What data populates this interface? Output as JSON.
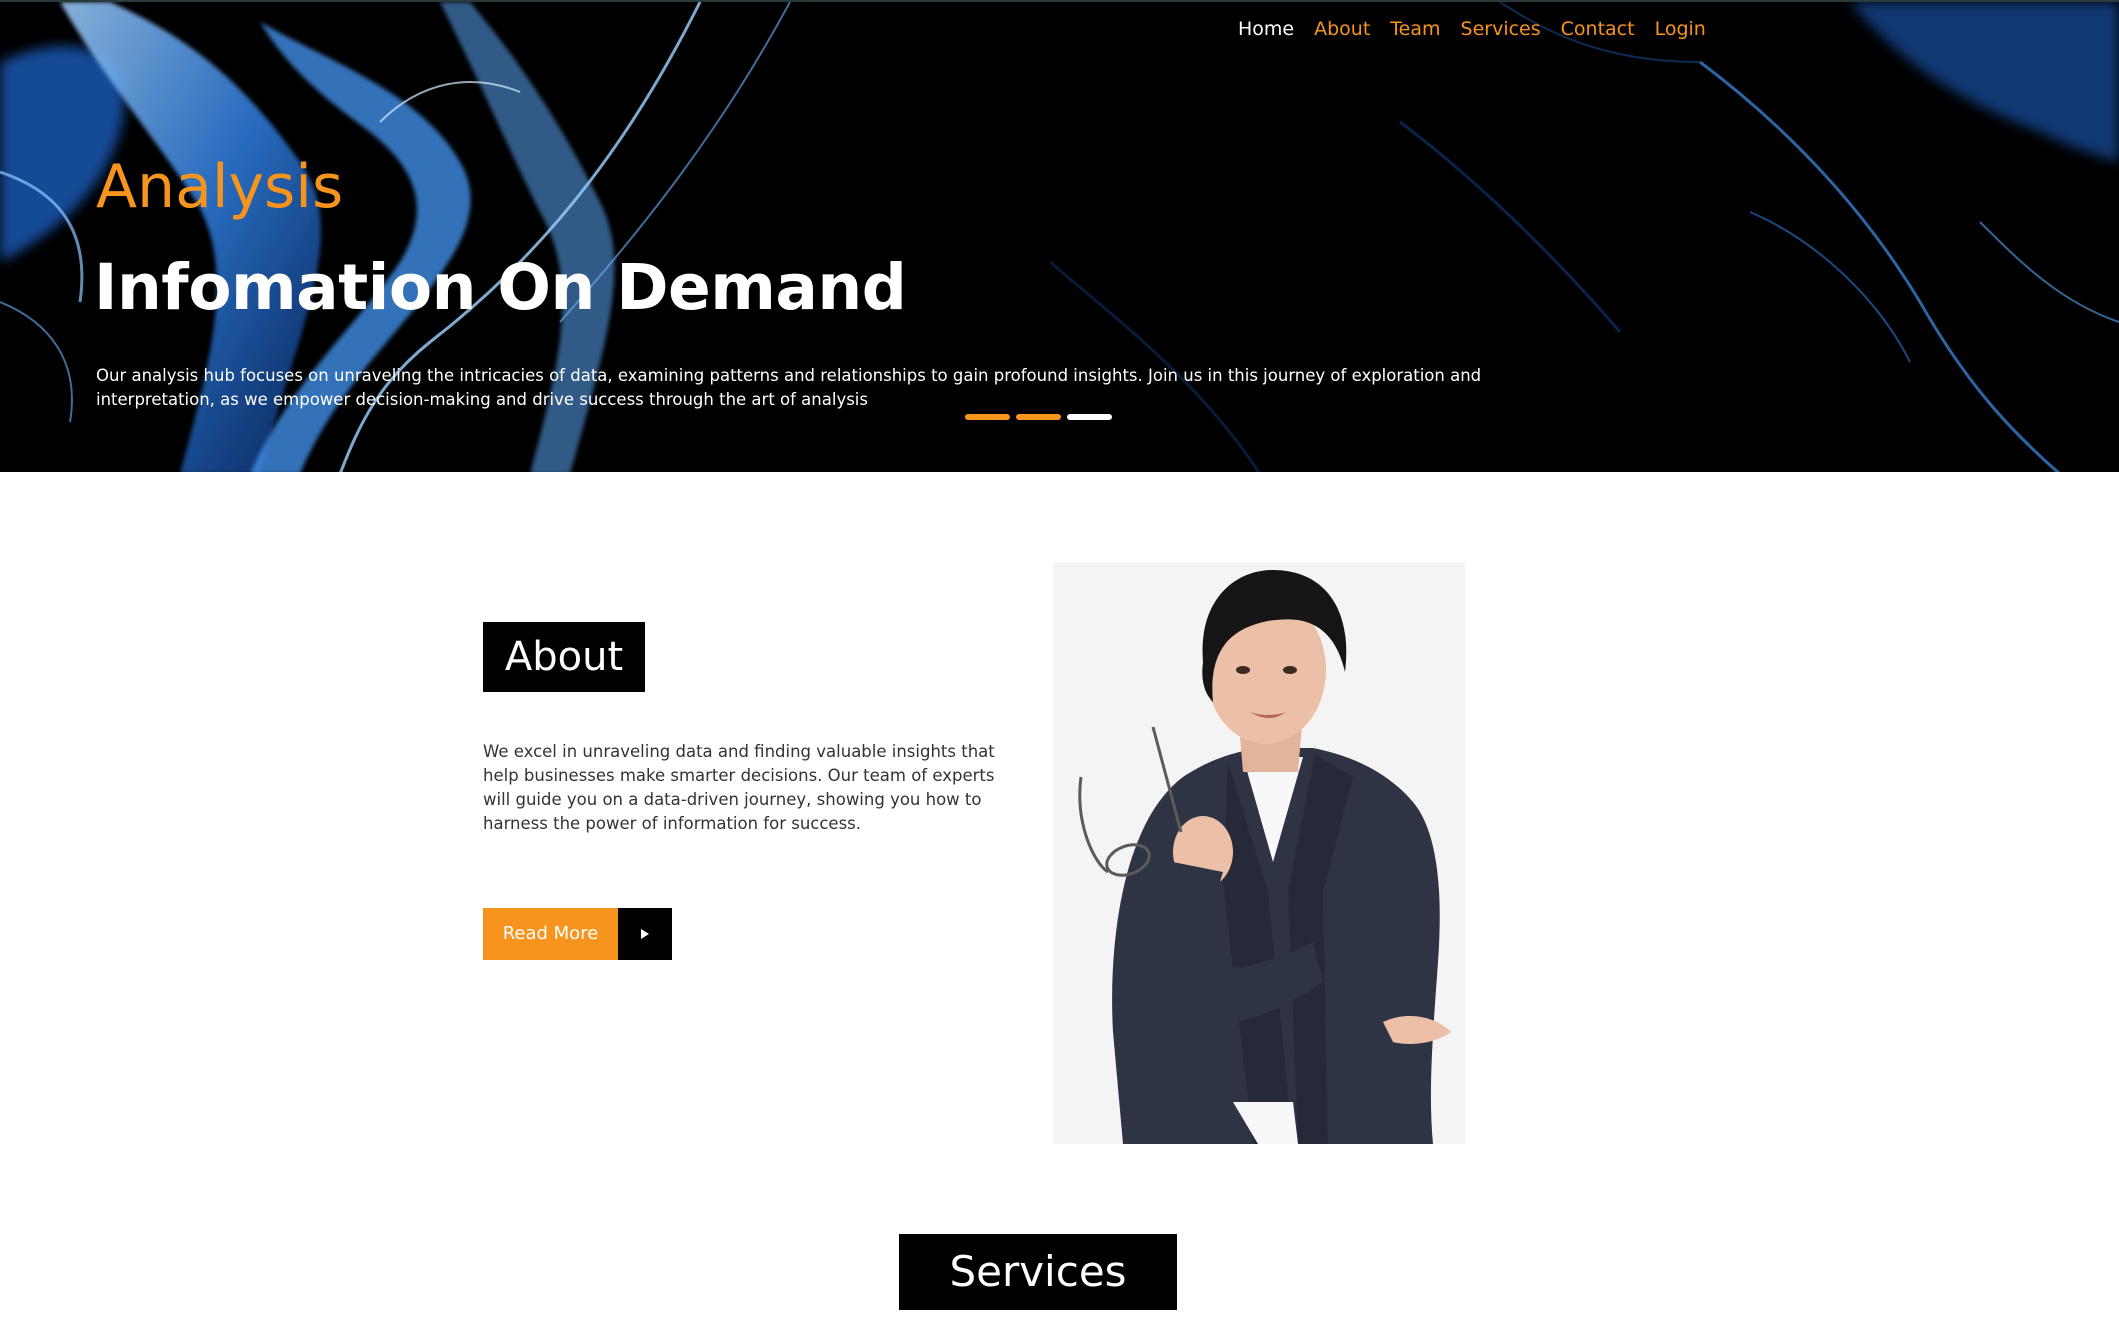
{
  "nav": {
    "items": [
      {
        "label": "Home",
        "active": true
      },
      {
        "label": "About",
        "active": false
      },
      {
        "label": "Team",
        "active": false
      },
      {
        "label": "Services",
        "active": false
      },
      {
        "label": "Contact",
        "active": false
      },
      {
        "label": "Login",
        "active": false
      }
    ]
  },
  "hero": {
    "eyebrow": "Analysis",
    "title": "Infomation On Demand",
    "description": "Our analysis hub focuses on unraveling the intricacies of data, examining patterns and relationships to gain profound insights. Join us in this journey of exploration and interpretation, as we empower decision-making and drive success through the art of analysis",
    "slide_count": 3,
    "current_slide": 3
  },
  "about": {
    "heading": "About",
    "text": "We excel in unraveling data and finding valuable insights that help businesses make smarter decisions. Our team of experts will guide you on a data-driven journey, showing you how to harness the power of information for success.",
    "button_label": "Read More",
    "button_icon": "play-arrow-icon",
    "image": "businesswoman-portrait"
  },
  "services": {
    "heading": "Services"
  },
  "colors": {
    "accent": "#f7941d",
    "hero_background": "#000000",
    "glow_blue": "#3f8fe8",
    "heading_block": "#000000"
  }
}
